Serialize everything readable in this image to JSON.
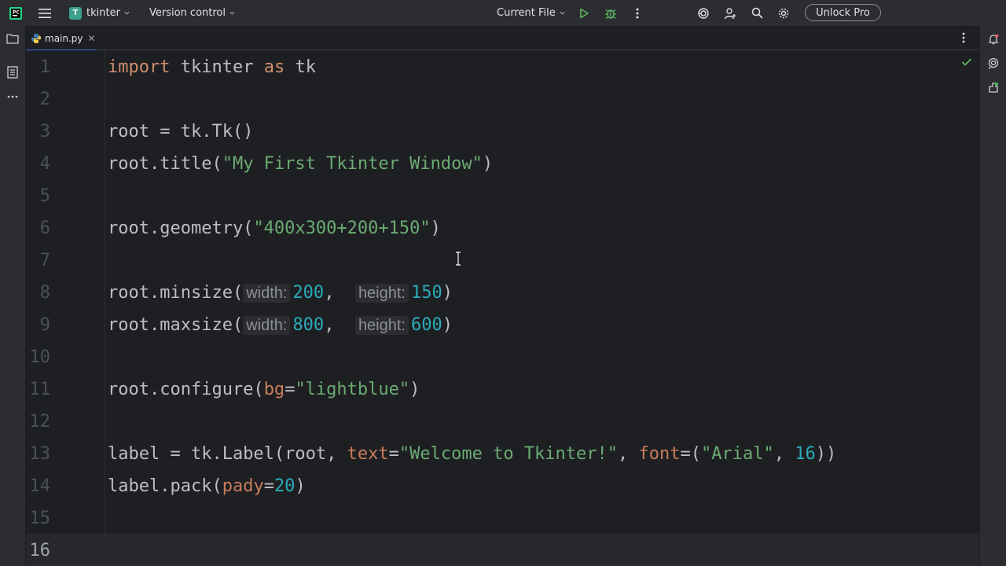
{
  "titlebar": {
    "project_badge": "T",
    "project_name": "tkinter",
    "vcs_label": "Version control",
    "run_config": "Current File",
    "unlock_label": "Unlock Pro"
  },
  "tabs": [
    {
      "label": "main.py",
      "active": true
    }
  ],
  "editor": {
    "current_line": 16,
    "line_numbers": [
      "1",
      "2",
      "3",
      "4",
      "5",
      "6",
      "7",
      "8",
      "9",
      "10",
      "11",
      "12",
      "13",
      "14",
      "15",
      "16"
    ],
    "lines": [
      {
        "segments": [
          {
            "t": "import",
            "c": "kw"
          },
          {
            "t": " tkinter ",
            "c": "plain"
          },
          {
            "t": "as",
            "c": "kw"
          },
          {
            "t": " tk",
            "c": "plain"
          }
        ]
      },
      {
        "segments": []
      },
      {
        "segments": [
          {
            "t": "root = tk.Tk()",
            "c": "plain"
          }
        ]
      },
      {
        "segments": [
          {
            "t": "root.title(",
            "c": "plain"
          },
          {
            "t": "\"My First Tkinter Window\"",
            "c": "str"
          },
          {
            "t": ")",
            "c": "plain"
          }
        ]
      },
      {
        "segments": []
      },
      {
        "segments": [
          {
            "t": "root.geometry(",
            "c": "plain"
          },
          {
            "t": "\"400x300+200+150\"",
            "c": "str"
          },
          {
            "t": ")",
            "c": "plain"
          }
        ]
      },
      {
        "segments": []
      },
      {
        "segments": [
          {
            "t": "root.minsize(",
            "c": "plain"
          },
          {
            "t": "width:",
            "c": "hint"
          },
          {
            "t": "200",
            "c": "num"
          },
          {
            "t": ",  ",
            "c": "plain"
          },
          {
            "t": "height:",
            "c": "hint"
          },
          {
            "t": "150",
            "c": "num"
          },
          {
            "t": ")",
            "c": "plain"
          }
        ]
      },
      {
        "segments": [
          {
            "t": "root.maxsize(",
            "c": "plain"
          },
          {
            "t": "width:",
            "c": "hint"
          },
          {
            "t": "800",
            "c": "num"
          },
          {
            "t": ",  ",
            "c": "plain"
          },
          {
            "t": "height:",
            "c": "hint"
          },
          {
            "t": "600",
            "c": "num"
          },
          {
            "t": ")",
            "c": "plain"
          }
        ]
      },
      {
        "segments": []
      },
      {
        "segments": [
          {
            "t": "root.configure(",
            "c": "plain"
          },
          {
            "t": "bg",
            "c": "param"
          },
          {
            "t": "=",
            "c": "plain"
          },
          {
            "t": "\"lightblue\"",
            "c": "str"
          },
          {
            "t": ")",
            "c": "plain"
          }
        ]
      },
      {
        "segments": []
      },
      {
        "segments": [
          {
            "t": "label = tk.Label(root, ",
            "c": "plain"
          },
          {
            "t": "text",
            "c": "param"
          },
          {
            "t": "=",
            "c": "plain"
          },
          {
            "t": "\"Welcome to Tkinter!\"",
            "c": "str"
          },
          {
            "t": ", ",
            "c": "plain"
          },
          {
            "t": "font",
            "c": "param"
          },
          {
            "t": "=(",
            "c": "plain"
          },
          {
            "t": "\"Arial\"",
            "c": "str"
          },
          {
            "t": ", ",
            "c": "plain"
          },
          {
            "t": "16",
            "c": "num"
          },
          {
            "t": "))",
            "c": "plain"
          }
        ]
      },
      {
        "segments": [
          {
            "t": "label.pack(",
            "c": "plain"
          },
          {
            "t": "pady",
            "c": "param"
          },
          {
            "t": "=",
            "c": "plain"
          },
          {
            "t": "20",
            "c": "num"
          },
          {
            "t": ")",
            "c": "plain"
          }
        ]
      },
      {
        "segments": []
      },
      {
        "segments": []
      }
    ]
  },
  "colors": {
    "background": "#1e1f22",
    "panel": "#2b2d30",
    "keyword": "#cf8e6d",
    "string": "#6aab73",
    "number": "#2aacb8",
    "parameter": "#c77d5b",
    "accent": "#3574f0",
    "run_green": "#5fb865"
  },
  "icons": [
    "pycharm-logo-icon",
    "hamburger-menu-icon",
    "run-icon",
    "debug-icon",
    "more-vertical-icon",
    "ai-assistant-icon",
    "add-user-icon",
    "search-icon",
    "settings-gear-icon",
    "folder-icon",
    "structure-icon",
    "more-horizontal-icon",
    "python-file-icon",
    "notifications-icon",
    "ai-chat-icon",
    "plugins-icon",
    "check-icon",
    "text-cursor-icon"
  ]
}
